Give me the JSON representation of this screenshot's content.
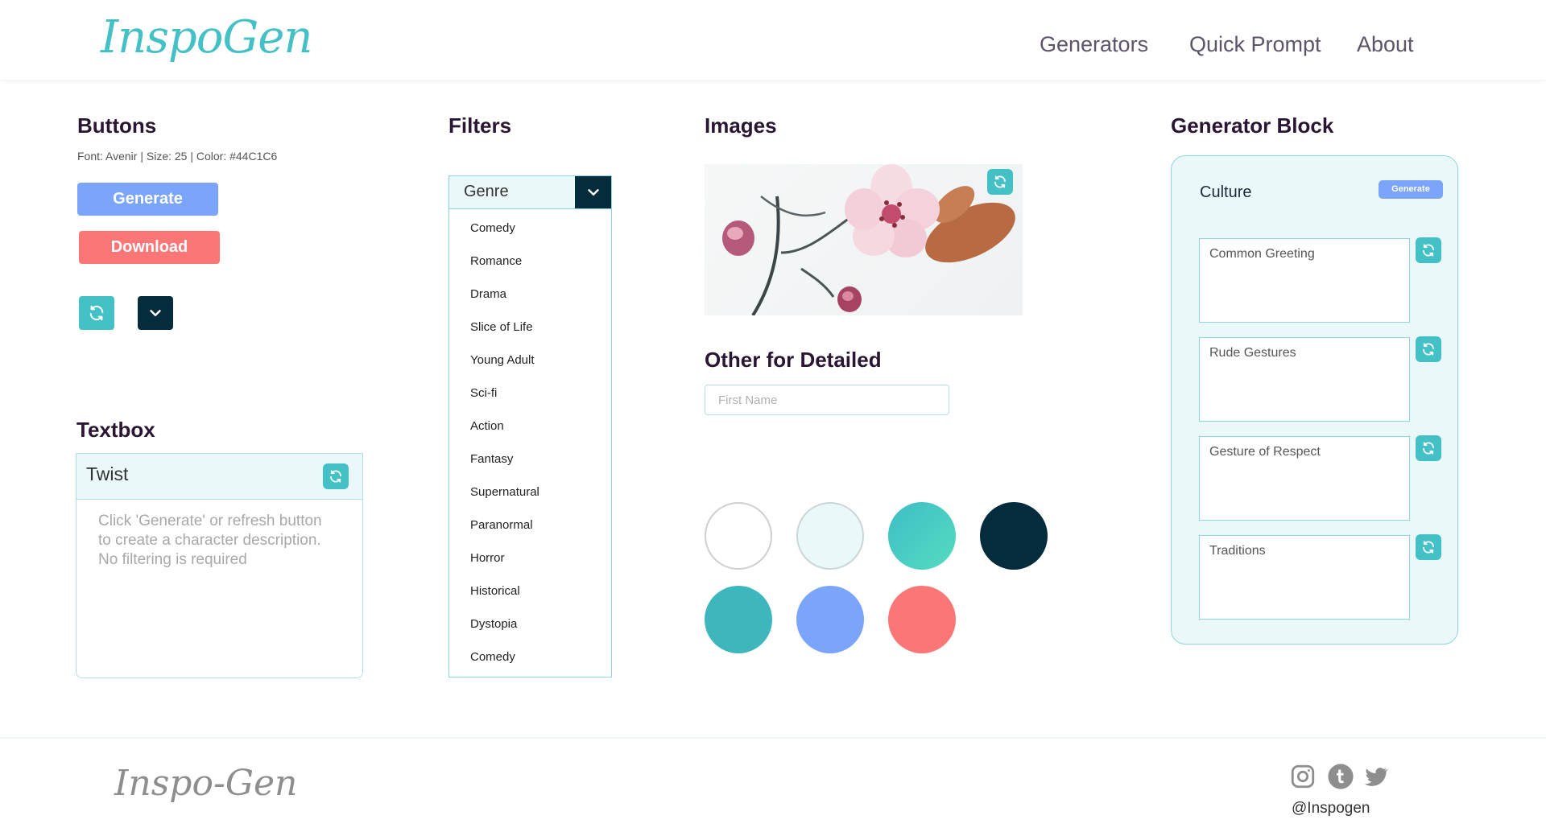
{
  "brand": {
    "logo_text": "InspoGen",
    "footer_logo_text": "Inspo-Gen",
    "accent": "#44C1C6"
  },
  "nav": {
    "items": [
      "Generators",
      "Quick Prompt",
      "About"
    ]
  },
  "buttons_section": {
    "title": "Buttons",
    "spec": "Font: Avenir |  Size: 25 | Color: #44C1C6",
    "generate_label": "Generate",
    "download_label": "Download",
    "generate_color": "#7aa5fa",
    "download_color": "#fb7777",
    "refresh_icon": "refresh-icon",
    "dropdown_icon": "chevron-down-icon"
  },
  "textbox_section": {
    "title": "Textbox",
    "box_title": "Twist",
    "placeholder": "Click 'Generate' or refresh button to create a character description. No filtering is required"
  },
  "filters_section": {
    "title": "Filters",
    "selected": "Genre",
    "options": [
      "Comedy",
      "Romance",
      "Drama",
      "Slice of Life",
      "Young Adult",
      "Sci-fi",
      "Action",
      "Fantasy",
      "Supernatural",
      "Paranormal",
      "Horror",
      "Historical",
      "Dystopia",
      "Comedy"
    ]
  },
  "images_section": {
    "title": "Images",
    "other_title": "Other for Detailed",
    "first_name_placeholder": "First Name",
    "swatches": [
      "#ffffff",
      "#ebf8f9",
      "#44C1C6",
      "#052c3d",
      "#3eb6bd",
      "#7aa5fa",
      "#fb7777"
    ]
  },
  "generator_block": {
    "title": "Generator Block",
    "block_title": "Culture",
    "button_label": "Generate",
    "fields": [
      "Common Greeting",
      "Rude Gestures",
      "Gesture of Respect",
      "Traditions"
    ]
  },
  "footer": {
    "handle": "@Inspogen",
    "social_icons": [
      "instagram-icon",
      "tumblr-icon",
      "twitter-icon"
    ]
  }
}
